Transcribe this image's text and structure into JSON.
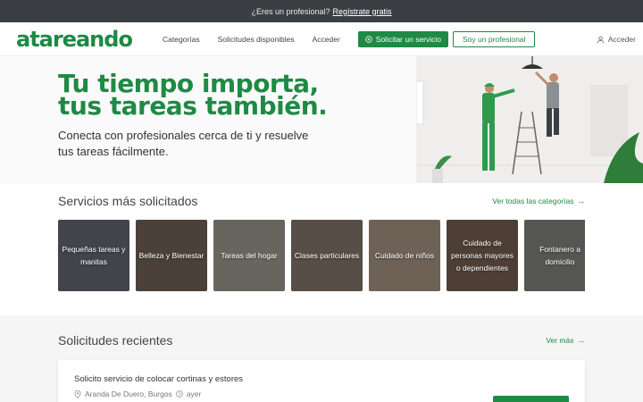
{
  "topbar": {
    "question": "¿Eres un profesional?",
    "link": "Regístrate gratis"
  },
  "nav": {
    "logo": "atareando",
    "links": [
      "Categorías",
      "Solicitudes disponibles",
      "Acceder"
    ],
    "cta_primary": "Solicitar un servicio",
    "cta_secondary": "Soy un profesional",
    "login": "Acceder"
  },
  "hero": {
    "title_line1": "Tu tiempo importa,",
    "title_line2": "tus tareas también.",
    "subtitle_line1": "Conecta con profesionales cerca de ti y resuelve",
    "subtitle_line2": "tus tareas fácilmente."
  },
  "services": {
    "title": "Servicios más solicitados",
    "link": "Ver todas las categorías",
    "categories": [
      {
        "label": "Pequeñas tareas y manitas",
        "color": "#6a6f78"
      },
      {
        "label": "Belleza y Bienestar",
        "color": "#7a6a5c"
      },
      {
        "label": "Tareas del hogar",
        "color": "#a8a399"
      },
      {
        "label": "Clases particulares",
        "color": "#8b7f73"
      },
      {
        "label": "Cuidado de niños",
        "color": "#b29e8c"
      },
      {
        "label": "Cuidado de personas mayores o dependientes",
        "color": "#7d6656"
      },
      {
        "label": "Fontanero a domicilio",
        "color": "#8a8985"
      }
    ]
  },
  "recent": {
    "title": "Solicitudes recientes",
    "link": "Ver más",
    "card": {
      "title": "Solicito servicio de colocar cortinas y estores",
      "location": "Aranda De Duero, Burgos",
      "time": "ayer"
    }
  },
  "colors": {
    "brand": "#1e8a44",
    "topbar": "#3b3f44"
  }
}
